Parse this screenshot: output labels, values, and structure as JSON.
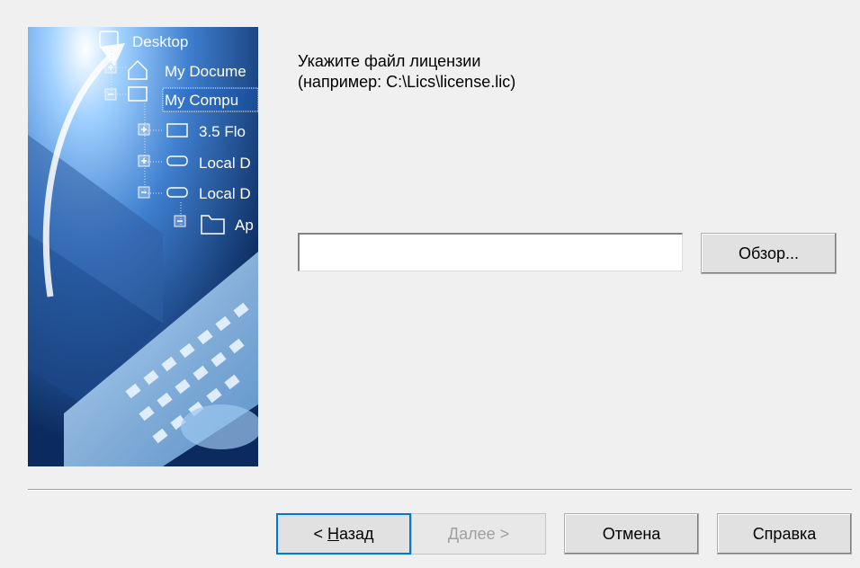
{
  "instruction": {
    "line1": "Укажите файл лицензии",
    "line2": "(например: C:\\Lics\\license.lic)"
  },
  "license_path": {
    "value": "",
    "placeholder": ""
  },
  "buttons": {
    "browse": "Обзор...",
    "back_prefix": "< ",
    "back_accel": "Н",
    "back_rest": "азад",
    "next_accel": "Д",
    "next_rest": "алее >",
    "cancel": "Отмена",
    "help": "Справка"
  },
  "banner_tree": {
    "desktop": "Desktop",
    "my_documents": "My Docume",
    "my_computer": "My Compu",
    "floppy": "3.5 Flo",
    "local_disk_1": "Local D",
    "local_disk_2": "Local D",
    "folder": "Ap"
  },
  "colors": {
    "dialog_bg": "#f0f0f0",
    "focus_border": "#0078d7",
    "disabled_text": "#a0a0a0",
    "banner_dark": "#0e2f66",
    "banner_light": "#5fa8e6"
  }
}
